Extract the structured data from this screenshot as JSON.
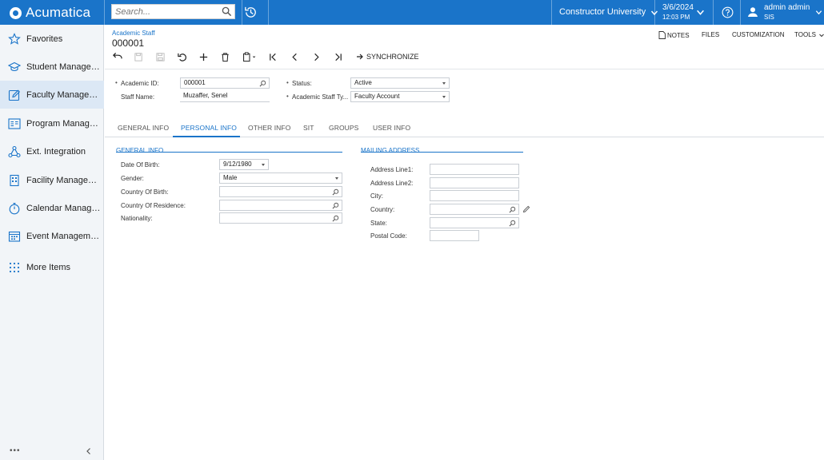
{
  "app": {
    "logo_text": "Acumatica",
    "brand_color": "#1a74c9"
  },
  "topbar": {
    "search_placeholder": "Search...",
    "company": "Constructor University",
    "date": "3/6/2024",
    "time": "12:03 PM",
    "user_name": "admin admin",
    "tenant": "SIS"
  },
  "sidebar": {
    "items": [
      {
        "label": "Favorites",
        "icon": "star-icon"
      },
      {
        "label": "Student Management",
        "icon": "graduation-cap-icon"
      },
      {
        "label": "Faculty Management",
        "icon": "edit-icon",
        "active": true
      },
      {
        "label": "Program Management",
        "icon": "program-icon"
      },
      {
        "label": "Ext. Integration",
        "icon": "integration-icon"
      },
      {
        "label": "Facility Management",
        "icon": "building-icon"
      },
      {
        "label": "Calendar Management",
        "icon": "stopwatch-icon"
      },
      {
        "label": "Event Management",
        "icon": "calendar-grid-icon"
      },
      {
        "label": "More Items",
        "icon": "grid-dots-icon"
      }
    ],
    "footer_dots": "•••"
  },
  "page": {
    "breadcrumb": "Academic Staff",
    "title": "000001",
    "actions": {
      "notes": "NOTES",
      "files": "FILES",
      "customization": "CUSTOMIZATION",
      "tools": "TOOLS"
    },
    "synchronize": "SYNCHRONIZE"
  },
  "header_form": {
    "academic_id_label": "Academic ID:",
    "academic_id_value": "000001",
    "staff_name_label": "Staff Name:",
    "staff_name_value": "Muzaffer, Senel",
    "status_label": "Status:",
    "status_value": "Active",
    "staff_type_label": "Academic Staff Ty...",
    "staff_type_value": "Faculty Account"
  },
  "tabs": [
    "GENERAL INFO",
    "PERSONAL INFO",
    "OTHER INFO",
    "SIT",
    "GROUPS",
    "USER INFO"
  ],
  "active_tab": "PERSONAL INFO",
  "general_info": {
    "title": "GENERAL INFO",
    "dob_label": "Date Of Birth:",
    "dob_value": "9/12/1980",
    "gender_label": "Gender:",
    "gender_value": "Male",
    "country_birth_label": "Country Of Birth:",
    "country_birth_value": "",
    "country_residence_label": "Country Of Residence:",
    "country_residence_value": "",
    "nationality_label": "Nationality:",
    "nationality_value": ""
  },
  "mailing_address": {
    "title": "MAILING ADDRESS",
    "line1_label": "Address Line1:",
    "line1_value": "",
    "line2_label": "Address Line2:",
    "line2_value": "",
    "city_label": "City:",
    "city_value": "",
    "country_label": "Country:",
    "country_value": "",
    "state_label": "State:",
    "state_value": "",
    "postal_label": "Postal Code:",
    "postal_value": ""
  }
}
